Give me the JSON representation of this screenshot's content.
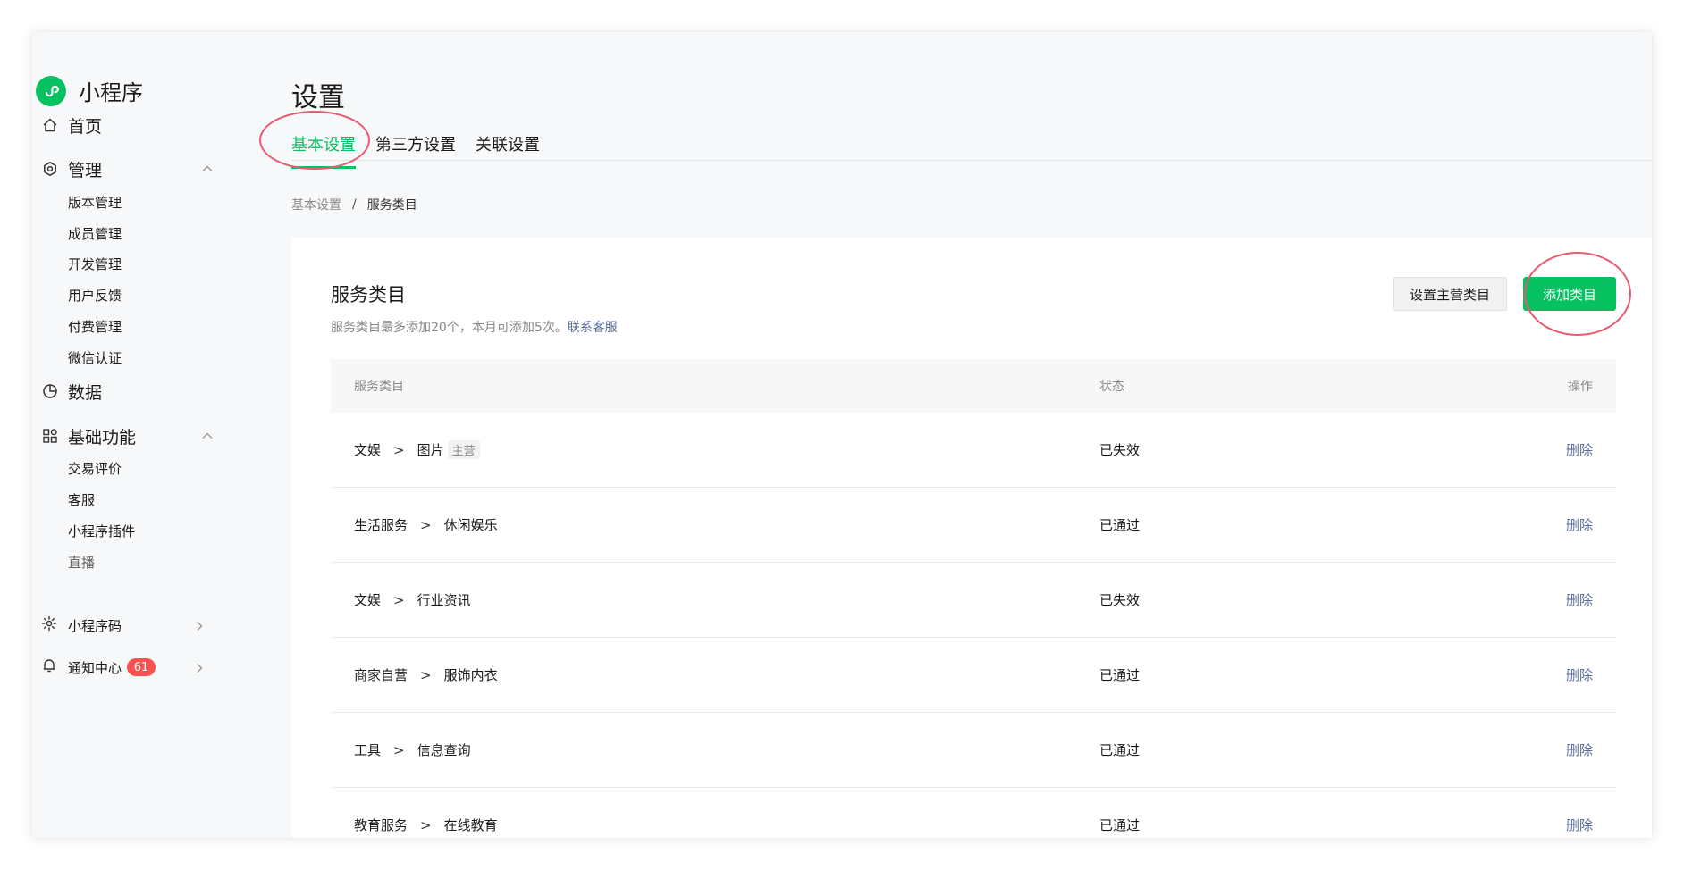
{
  "app": {
    "title": "小程序"
  },
  "sidebar": {
    "home": {
      "label": "首页",
      "icon": "home-icon"
    },
    "manage": {
      "label": "管理",
      "icon": "manage-icon",
      "items": [
        "版本管理",
        "成员管理",
        "开发管理",
        "用户反馈",
        "付费管理",
        "微信认证"
      ]
    },
    "data": {
      "label": "数据",
      "icon": "chart-pie-icon"
    },
    "basic": {
      "label": "基础功能",
      "icon": "apps-grid-icon",
      "items": [
        "交易评价",
        "客服",
        "小程序插件",
        "直播"
      ]
    },
    "qrcode": {
      "label": "小程序码",
      "icon": "qrcode-sun-icon"
    },
    "notify": {
      "label": "通知中心",
      "badge": "61",
      "icon": "bell-icon"
    }
  },
  "header": {
    "title": "设置",
    "tabs": [
      "基本设置",
      "第三方设置",
      "关联设置"
    ],
    "active_tab": 0
  },
  "breadcrumb": {
    "parent": "基本设置",
    "separator": "/",
    "current": "服务类目"
  },
  "card": {
    "title": "服务类目",
    "desc": "服务类目最多添加20个，本月可添加5次。",
    "desc_link": "联系客服",
    "btn_set_main": "设置主营类目",
    "btn_add": "添加类目"
  },
  "table": {
    "headers": [
      "服务类目",
      "状态",
      "操作"
    ],
    "arrow": ">",
    "rows": [
      {
        "cat1": "文娱",
        "cat2": "图片",
        "tag": "主营",
        "status": "已失效",
        "op": "删除"
      },
      {
        "cat1": "生活服务",
        "cat2": "休闲娱乐",
        "tag": "",
        "status": "已通过",
        "op": "删除"
      },
      {
        "cat1": "文娱",
        "cat2": "行业资讯",
        "tag": "",
        "status": "已失效",
        "op": "删除"
      },
      {
        "cat1": "商家自营",
        "cat2": "服饰内衣",
        "tag": "",
        "status": "已通过",
        "op": "删除"
      },
      {
        "cat1": "工具",
        "cat2": "信息查询",
        "tag": "",
        "status": "已通过",
        "op": "删除"
      },
      {
        "cat1": "教育服务",
        "cat2": "在线教育",
        "tag": "",
        "status": "已通过",
        "op": "删除"
      }
    ]
  },
  "colors": {
    "brand": "#07c160",
    "link": "#576b95",
    "badge": "#fa5151",
    "annotation": "#e85a71"
  }
}
